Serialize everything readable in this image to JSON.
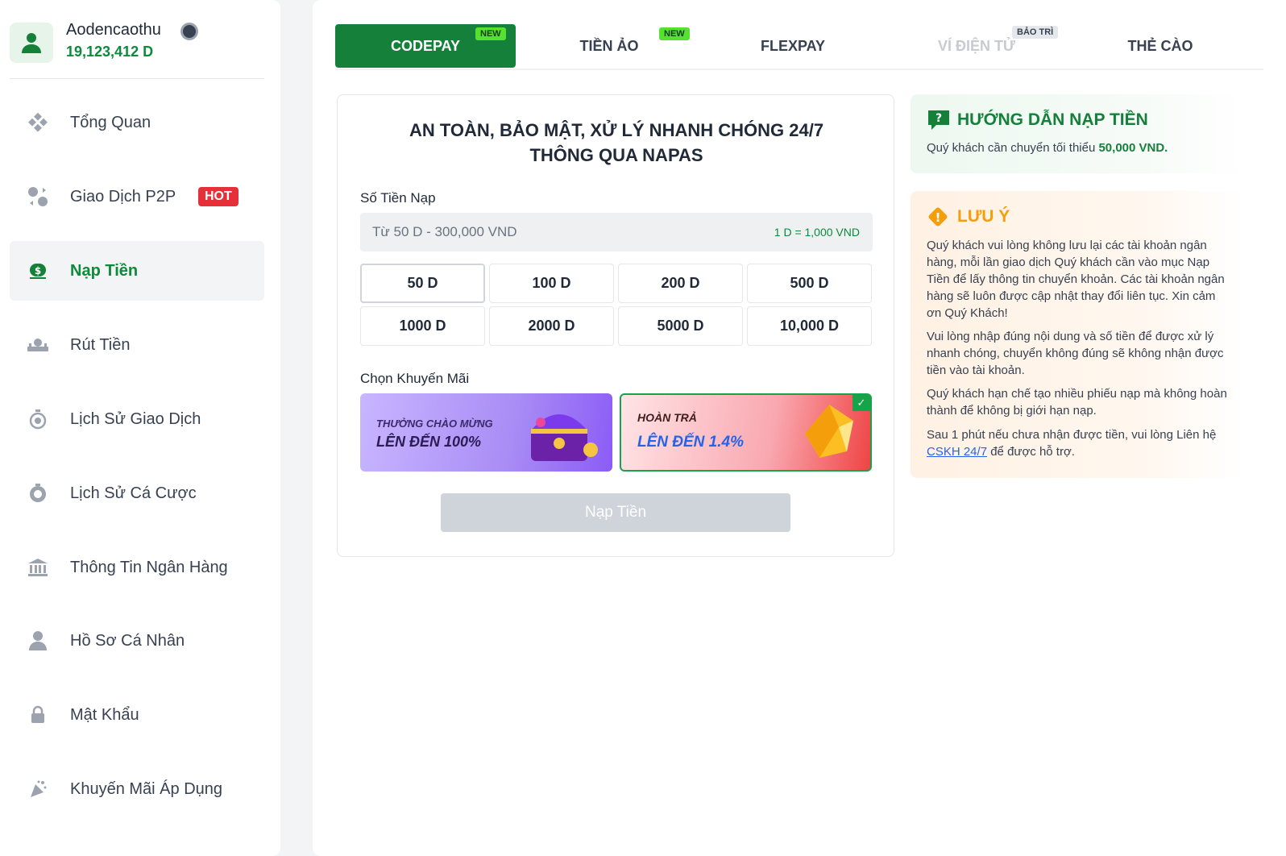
{
  "user": {
    "name": "Aodencaothu",
    "balance": "19,123,412 D"
  },
  "sidebar": {
    "items": [
      {
        "label": "Tổng Quan",
        "icon": "overview-icon"
      },
      {
        "label": "Giao Dịch P2P",
        "icon": "p2p-icon",
        "badge": "HOT"
      },
      {
        "label": "Nạp Tiền",
        "icon": "deposit-icon",
        "active": true
      },
      {
        "label": "Rút Tiền",
        "icon": "withdraw-icon"
      },
      {
        "label": "Lịch Sử Giao Dịch",
        "icon": "transaction-history-icon"
      },
      {
        "label": "Lịch Sử Cá Cược",
        "icon": "bet-history-icon"
      },
      {
        "label": "Thông Tin Ngân Hàng",
        "icon": "bank-icon"
      },
      {
        "label": "Hồ Sơ Cá Nhân",
        "icon": "profile-icon"
      },
      {
        "label": "Mật Khẩu",
        "icon": "lock-icon"
      },
      {
        "label": "Khuyến Mãi Áp Dụng",
        "icon": "promotion-icon"
      }
    ]
  },
  "tabs": [
    {
      "label": "CODEPAY",
      "tag": "NEW"
    },
    {
      "label": "TIỀN ẢO",
      "tag": "NEW"
    },
    {
      "label": "FLEXPAY"
    },
    {
      "label": "VÍ ĐIỆN TỬ",
      "tag": "BẢO TRÌ"
    },
    {
      "label": "THẺ CÀO"
    }
  ],
  "deposit": {
    "title_line1": "AN TOÀN, BẢO MẬT, XỬ LÝ NHANH CHÓNG 24/7",
    "title_line2": "THÔNG QUA NAPAS",
    "amount_label": "Số Tiền Nạp",
    "amount_placeholder": "Từ 50 D - 300,000 VND",
    "rate": "1 D = 1,000 VND",
    "amounts": [
      "50 D",
      "100 D",
      "200 D",
      "500 D",
      "1000 D",
      "2000 D",
      "5000 D",
      "10,000 D"
    ],
    "promo_label": "Chọn Khuyến Mãi",
    "promo1_line1": "THƯỞNG CHÀO MỪNG",
    "promo1_line2": "LÊN ĐẾN 100%",
    "promo2_line1": "HOÀN TRẢ",
    "promo2_line2": "LÊN ĐẾN 1.4%",
    "submit": "Nạp Tiền"
  },
  "guide": {
    "title": "HƯỚNG DẪN NẠP TIỀN",
    "text": "Quý khách cần chuyển tối thiểu",
    "min": "50,000 VND."
  },
  "note": {
    "title": "LƯU Ý",
    "p1": "Quý khách vui lòng không lưu lại các tài khoản ngân hàng, mỗi lần giao dịch Quý khách cần vào mục Nạp Tiền để lấy thông tin chuyển khoản. Các tài khoản ngân hàng sẽ luôn được cập nhật thay đổi liên tục. Xin cảm ơn Quý Khách!",
    "p2": "Vui lòng nhập đúng nội dung và số tiền để được xử lý nhanh chóng, chuyển không đúng sẽ không nhận được tiền vào tài khoản.",
    "p3": "Quý khách hạn chế tạo nhiều phiếu nạp mà không hoàn thành để không bị giới hạn nạp.",
    "p4_before": "Sau 1 phút nếu chưa nhận được tiền, vui lòng Liên hệ",
    "p4_link": "CSKH 24/7",
    "p4_after": "để được hỗ trợ."
  },
  "colors": {
    "brand": "#14803a",
    "accent_green": "#0d8a3a",
    "hot": "#e5303a",
    "warn": "#f59e0b"
  }
}
